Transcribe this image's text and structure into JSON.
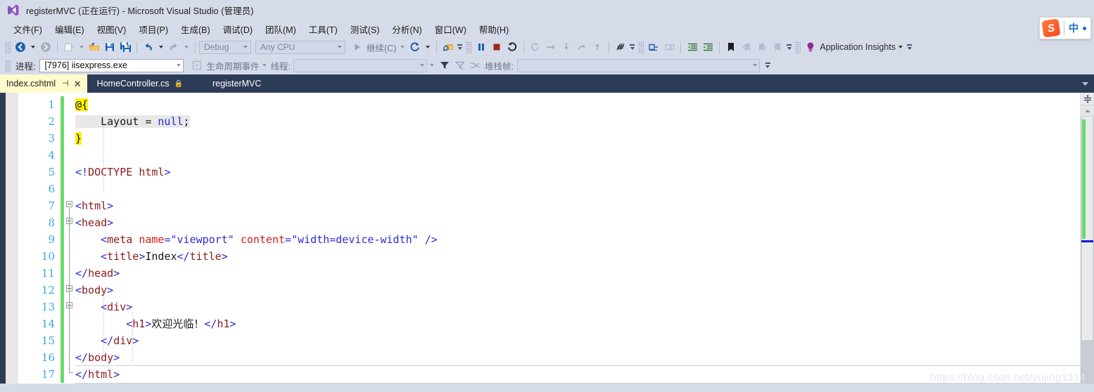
{
  "window": {
    "title": "registerMVC (正在运行) - Microsoft Visual Studio (管理员)",
    "logo_icon": "visual-studio-logo-icon"
  },
  "menubar": {
    "items": [
      {
        "label": "文件(F)"
      },
      {
        "label": "编辑(E)"
      },
      {
        "label": "视图(V)"
      },
      {
        "label": "项目(P)"
      },
      {
        "label": "生成(B)"
      },
      {
        "label": "调试(D)"
      },
      {
        "label": "团队(M)"
      },
      {
        "label": "工具(T)"
      },
      {
        "label": "测试(S)"
      },
      {
        "label": "分析(N)"
      },
      {
        "label": "窗口(W)"
      },
      {
        "label": "帮助(H)"
      }
    ]
  },
  "toolbar": {
    "navigate_back_icon": "navigate-back-icon",
    "navigate_forward_icon": "navigate-forward-icon",
    "new_project_icon": "new-project-icon",
    "open_file_icon": "open-file-icon",
    "save_icon": "save-icon",
    "save_all_icon": "save-all-icon",
    "undo_icon": "undo-icon",
    "redo_icon": "redo-icon",
    "config_value": "Debug",
    "platform_value": "Any CPU",
    "start_icon": "start-run-icon",
    "continue_label": "继续(C)",
    "hot_reload_icon": "hot-reload-icon",
    "attach_icon": "attach-to-process-icon",
    "pause_icon": "pause-icon",
    "stop_icon": "stop-icon",
    "restart_icon": "restart-icon",
    "show_next_statement_icon": "show-next-statement-icon",
    "step_over_icon": "step-over-icon",
    "step_into_icon": "step-into-icon",
    "step_out_icon": "step-out-icon",
    "step_return_icon": "step-return-icon",
    "intellitrace_icon": "intellitrace-icon",
    "comment_icon": "comment-selection-icon",
    "uncomment_icon": "uncomment-selection-icon",
    "decrease_indent_icon": "decrease-indent-icon",
    "increase_indent_icon": "increase-indent-icon",
    "bookmark_icon": "bookmark-icon",
    "prev_bookmark_icon": "previous-bookmark-icon",
    "next_bookmark_icon": "next-bookmark-icon",
    "clear_bookmarks_icon": "clear-bookmarks-icon",
    "app_insights_icon": "application-insights-bulb-icon",
    "app_insights_label": "Application Insights",
    "overflow_icon": "toolbar-overflow-icon"
  },
  "debug_bar": {
    "process_label": "进程:",
    "process_value": "[7976] iisexpress.exe",
    "lifecycle_icon": "lifecycle-events-icon",
    "lifecycle_label": "生命周期事件",
    "thread_label": "线程:",
    "thread_value": "",
    "filter_icon": "filter-icon",
    "filter_clear_icon": "clear-filter-icon",
    "shuffle_icon": "toggle-threads-icon",
    "stackframe_label": "堆栈帧:",
    "stackframe_value": "",
    "overflow_icon": "toolbar-overflow-icon"
  },
  "tabs": {
    "items": [
      {
        "label": "Index.cshtml",
        "active": true,
        "pin_icon": "pin-icon",
        "close_icon": "close-icon"
      },
      {
        "label": "HomeController.cs",
        "active": false,
        "lock_icon": "preview-lock-icon"
      },
      {
        "label": "registerMVC",
        "active": false
      }
    ],
    "nav_overflow_icon": "tab-overflow-icon"
  },
  "editor": {
    "filename": "Index.cshtml",
    "line_numbers": [
      1,
      2,
      3,
      4,
      5,
      6,
      7,
      8,
      9,
      10,
      11,
      12,
      13,
      14,
      15,
      16,
      17
    ],
    "current_line": 17,
    "lines": [
      {
        "n": 1,
        "indent": 0,
        "tokens": [
          {
            "t": "@{",
            "c": "razor"
          }
        ]
      },
      {
        "n": 2,
        "indent": 0,
        "tokens": [
          {
            "t": "    Layout = ",
            "c": "rzbg"
          },
          {
            "t": "null",
            "c": "kw rzbg"
          },
          {
            "t": ";",
            "c": "rzbg"
          }
        ]
      },
      {
        "n": 3,
        "indent": 0,
        "tokens": [
          {
            "t": "}",
            "c": "razor"
          }
        ]
      },
      {
        "n": 4,
        "indent": 0,
        "tokens": []
      },
      {
        "n": 5,
        "indent": 0,
        "tokens": [
          {
            "t": "<!",
            "c": "tag"
          },
          {
            "t": "DOCTYPE",
            "c": "name"
          },
          {
            "t": " ",
            "c": "txt"
          },
          {
            "t": "html",
            "c": "name"
          },
          {
            "t": ">",
            "c": "tag"
          }
        ]
      },
      {
        "n": 6,
        "indent": 0,
        "tokens": []
      },
      {
        "n": 7,
        "indent": 0,
        "tokens": [
          {
            "t": "<",
            "c": "tag"
          },
          {
            "t": "html",
            "c": "name"
          },
          {
            "t": ">",
            "c": "tag"
          }
        ]
      },
      {
        "n": 8,
        "indent": 0,
        "tokens": [
          {
            "t": "<",
            "c": "tag"
          },
          {
            "t": "head",
            "c": "name"
          },
          {
            "t": ">",
            "c": "tag"
          }
        ]
      },
      {
        "n": 9,
        "indent": 1,
        "tokens": [
          {
            "t": "<",
            "c": "tag"
          },
          {
            "t": "meta",
            "c": "name"
          },
          {
            "t": " ",
            "c": "txt"
          },
          {
            "t": "name",
            "c": "attr"
          },
          {
            "t": "=",
            "c": "tag"
          },
          {
            "t": "\"viewport\"",
            "c": "val"
          },
          {
            "t": " ",
            "c": "txt"
          },
          {
            "t": "content",
            "c": "attr"
          },
          {
            "t": "=",
            "c": "tag"
          },
          {
            "t": "\"width=device-width\"",
            "c": "val"
          },
          {
            "t": " ",
            "c": "txt"
          },
          {
            "t": "/>",
            "c": "tag"
          }
        ]
      },
      {
        "n": 10,
        "indent": 1,
        "tokens": [
          {
            "t": "<",
            "c": "tag"
          },
          {
            "t": "title",
            "c": "name"
          },
          {
            "t": ">",
            "c": "tag"
          },
          {
            "t": "Index",
            "c": "txt"
          },
          {
            "t": "</",
            "c": "tag"
          },
          {
            "t": "title",
            "c": "name"
          },
          {
            "t": ">",
            "c": "tag"
          }
        ]
      },
      {
        "n": 11,
        "indent": 0,
        "tokens": [
          {
            "t": "</",
            "c": "tag"
          },
          {
            "t": "head",
            "c": "name"
          },
          {
            "t": ">",
            "c": "tag"
          }
        ]
      },
      {
        "n": 12,
        "indent": 0,
        "tokens": [
          {
            "t": "<",
            "c": "tag"
          },
          {
            "t": "body",
            "c": "name"
          },
          {
            "t": ">",
            "c": "tag"
          }
        ]
      },
      {
        "n": 13,
        "indent": 1,
        "tokens": [
          {
            "t": "<",
            "c": "tag"
          },
          {
            "t": "div",
            "c": "name"
          },
          {
            "t": ">",
            "c": "tag"
          }
        ]
      },
      {
        "n": 14,
        "indent": 2,
        "tokens": [
          {
            "t": "<",
            "c": "tag"
          },
          {
            "t": "h1",
            "c": "name"
          },
          {
            "t": ">",
            "c": "tag"
          },
          {
            "t": "欢迎光临！",
            "c": "txt"
          },
          {
            "t": "</",
            "c": "tag"
          },
          {
            "t": "h1",
            "c": "name"
          },
          {
            "t": ">",
            "c": "tag"
          }
        ]
      },
      {
        "n": 15,
        "indent": 1,
        "tokens": [
          {
            "t": "</",
            "c": "tag"
          },
          {
            "t": "div",
            "c": "name"
          },
          {
            "t": ">",
            "c": "tag"
          }
        ]
      },
      {
        "n": 16,
        "indent": 0,
        "tokens": [
          {
            "t": "</",
            "c": "tag"
          },
          {
            "t": "body",
            "c": "name"
          },
          {
            "t": ">",
            "c": "tag"
          }
        ]
      },
      {
        "n": 17,
        "indent": 0,
        "tokens": [
          {
            "t": "</",
            "c": "tag"
          },
          {
            "t": "html",
            "c": "name"
          },
          {
            "t": ">",
            "c": "tag"
          }
        ]
      }
    ],
    "fold_lines": [
      7,
      8,
      12,
      13
    ],
    "change_bar_color": "#6cdb6c",
    "razor_highlight_color": "#fff200"
  },
  "scrollbar": {
    "split_icon": "split-view-icon",
    "scroll_up_icon": "scroll-up-icon",
    "change_marker_color": "#6cdb6c",
    "caret_marker_color": "#1818d0"
  },
  "ime": {
    "logo_text": "S",
    "mode_label": "中",
    "logo_icon": "sogou-ime-logo-icon",
    "dot_icon": "ime-status-dot-icon"
  },
  "watermark": {
    "text": "https://blog.csdn.net/yujing1314"
  },
  "colors": {
    "chrome_bg": "#d6dbe9",
    "tabstrip_bg": "#2d3c56",
    "active_tab_bg": "#fffbcc",
    "editor_bg": "#ffffff",
    "line_number": "#3ba7e0",
    "tag": "#2b2bd0",
    "element_name": "#8b1a1a",
    "attribute": "#d01a1a"
  }
}
